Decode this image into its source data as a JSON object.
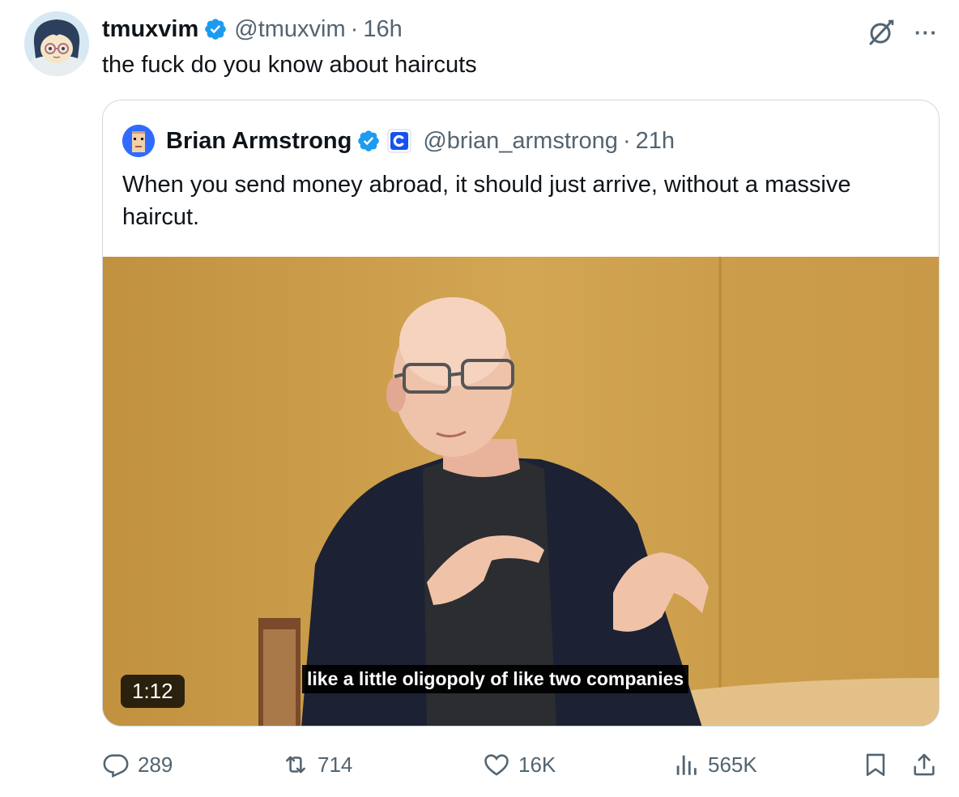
{
  "tweet": {
    "author_name": "tmuxvim",
    "handle": "@tmuxvim",
    "separator": "·",
    "time": "16h",
    "text": "the fuck do you know about haircuts",
    "more_label": "···"
  },
  "quote": {
    "author_name": "Brian Armstrong",
    "handle": "@brian_armstrong",
    "separator": "·",
    "time": "21h",
    "text": "When you send money abroad, it should just arrive, without a massive haircut.",
    "video": {
      "duration": "1:12",
      "caption": "like a little oligopoly of like two companies"
    }
  },
  "actions": {
    "replies": "289",
    "retweets": "714",
    "likes": "16K",
    "views": "565K"
  },
  "colors": {
    "verified_blue": "#1d9bf0",
    "muted_text": "#536471",
    "border": "#cfd9de",
    "coinbase_blue": "#1652f0"
  },
  "icons": [
    "verified-badge-icon",
    "grok-icon",
    "more-icon",
    "coinbase-org-icon",
    "reply-icon",
    "retweet-icon",
    "like-icon",
    "views-icon",
    "bookmark-icon",
    "share-icon"
  ]
}
